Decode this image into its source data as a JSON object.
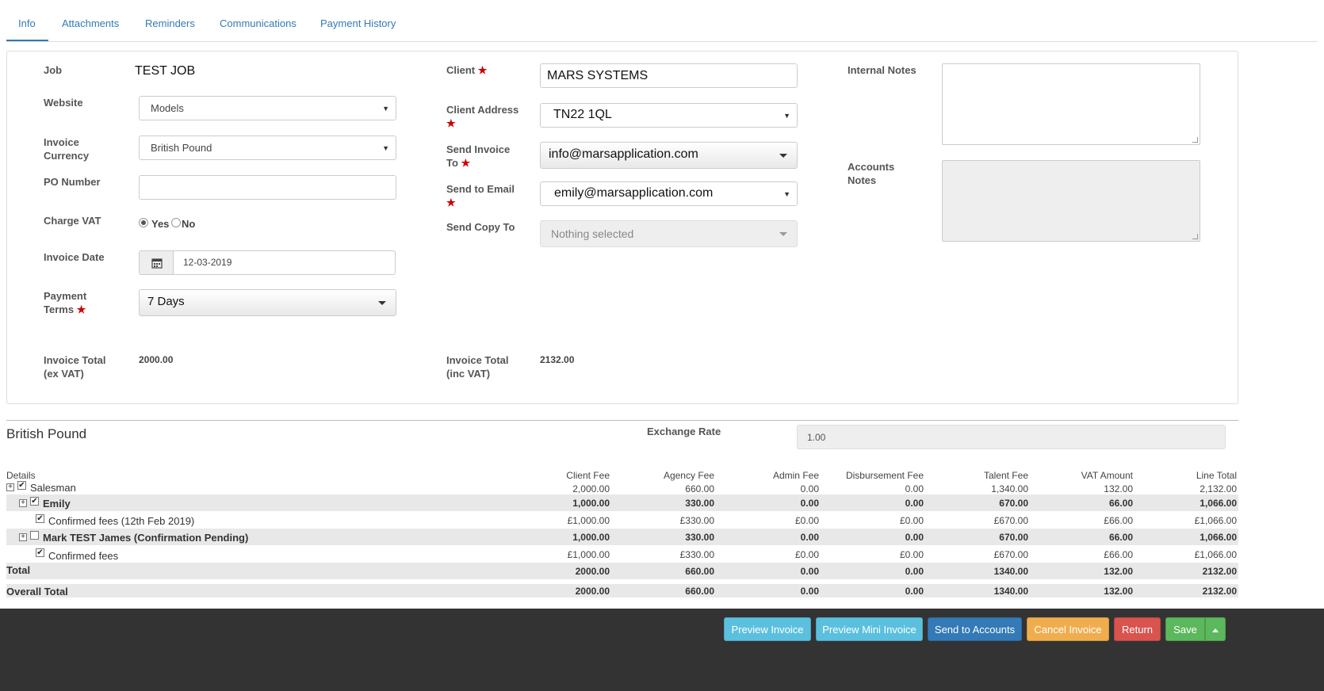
{
  "tabs": [
    "Info",
    "Attachments",
    "Reminders",
    "Communications",
    "Payment History"
  ],
  "form": {
    "job_label": "Job",
    "job_value": "TEST JOB",
    "website_label": "Website",
    "website_value": "Models",
    "currency_label": "Invoice Currency",
    "currency_value": "British Pound",
    "po_label": "PO Number",
    "po_value": "",
    "vat_label": "Charge VAT",
    "vat_yes": "Yes",
    "vat_no": "No",
    "vat_selected": "Yes",
    "date_label": "Invoice Date",
    "date_value": "12-03-2019",
    "terms_label": "Payment Terms",
    "terms_value": "7 Days",
    "total_ex_label": "Invoice Total (ex VAT)",
    "total_ex_value": "2000.00",
    "client_label": "Client",
    "client_value": "MARS SYSTEMS",
    "address_label": "Client Address",
    "address_value": "TN22 1QL",
    "send_to_label": "Send Invoice To",
    "send_to_value": "info@marsapplication.com",
    "email_label": "Send to Email",
    "email_value": "emily@marsapplication.com",
    "copy_label": "Send Copy To",
    "copy_value": "Nothing selected",
    "total_inc_label": "Invoice Total (inc VAT)",
    "total_inc_value": "2132.00",
    "internal_notes_label": "Internal Notes",
    "accounts_notes_label": "Accounts Notes",
    "required_mark": "★"
  },
  "currency_section": {
    "title": "British Pound",
    "exchange_label": "Exchange Rate",
    "exchange_value": "1.00"
  },
  "table": {
    "details_header": "Details",
    "columns": [
      "Client Fee",
      "Agency Fee",
      "Admin Fee",
      "Disbursement Fee",
      "Talent Fee",
      "VAT Amount",
      "Line Total"
    ],
    "summary_values": [
      "2,000.00",
      "660.00",
      "0.00",
      "0.00",
      "1,340.00",
      "132.00",
      "2,132.00"
    ],
    "rows": [
      {
        "label": "Salesman",
        "values": []
      },
      {
        "label": "Emily",
        "values": [
          "1,000.00",
          "330.00",
          "0.00",
          "0.00",
          "670.00",
          "66.00",
          "1,066.00"
        ]
      },
      {
        "label": "Confirmed fees (12th Feb 2019)",
        "values": [
          "£1,000.00",
          "£330.00",
          "£0.00",
          "£0.00",
          "£670.00",
          "£66.00",
          "£1,066.00"
        ]
      },
      {
        "label": "Mark TEST James (Confirmation Pending)",
        "values": [
          "1,000.00",
          "330.00",
          "0.00",
          "0.00",
          "670.00",
          "66.00",
          "1,066.00"
        ]
      },
      {
        "label": "Confirmed fees",
        "values": [
          "£1,000.00",
          "£330.00",
          "£0.00",
          "£0.00",
          "£670.00",
          "£66.00",
          "£1,066.00"
        ]
      },
      {
        "label": "Total",
        "values": [
          "2000.00",
          "660.00",
          "0.00",
          "0.00",
          "1340.00",
          "132.00",
          "2132.00"
        ]
      },
      {
        "label": "Overall Total",
        "values": [
          "2000.00",
          "660.00",
          "0.00",
          "0.00",
          "1340.00",
          "132.00",
          "2132.00"
        ]
      }
    ]
  },
  "footer": {
    "preview": "Preview Invoice",
    "preview_mini": "Preview Mini Invoice",
    "send_accounts": "Send to Accounts",
    "cancel": "Cancel Invoice",
    "return": "Return",
    "save": "Save"
  },
  "colors": {
    "accent": "#337ab7",
    "info_button": "#5bc0de",
    "primary_button": "#337ab7",
    "warning_button": "#f0ad4e",
    "danger_button": "#d9534f",
    "success_button": "#5cb85c",
    "required": "#cc0000"
  }
}
